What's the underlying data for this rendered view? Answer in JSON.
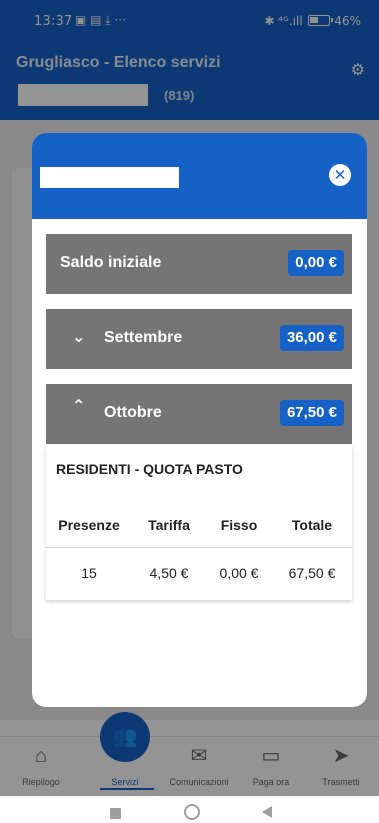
{
  "status_bar": {
    "time": "13:37",
    "left_icons": "▣ ▤ ⤓  ···",
    "signal": "✱ ⁴ᴳ.ıll",
    "battery": "46%"
  },
  "app_header": {
    "title": "Grugliasco - Elenco servizi",
    "count": "(819)",
    "settings_icon": "gear-icon"
  },
  "bottom_nav": {
    "items": [
      {
        "label": "Riepilogo",
        "icon": "home-icon"
      },
      {
        "label": "Servizi",
        "icon": "users-icon"
      },
      {
        "label": "Comunicazioni",
        "icon": "mail-icon"
      },
      {
        "label": "Paga ora",
        "icon": "wallet-icon"
      },
      {
        "label": "Trasmetti",
        "icon": "send-icon"
      }
    ]
  },
  "modal": {
    "close_icon": "close-icon",
    "rows": [
      {
        "label": "Saldo iniziale",
        "amount": "0,00 €",
        "expanded": null
      },
      {
        "label": "Settembre",
        "amount": "36,00 €",
        "expanded": false
      },
      {
        "label": "Ottobre",
        "amount": "67,50 €",
        "expanded": true
      }
    ],
    "detail": {
      "title": "RESIDENTI - QUOTA PASTO",
      "columns": [
        "Presenze",
        "Tariffa",
        "Fisso",
        "Totale"
      ],
      "rows": [
        [
          "15",
          "4,50 €",
          "0,00 €",
          "67,50 €"
        ]
      ]
    }
  },
  "colors": {
    "primary": "#1661c6",
    "row_gray": "#757575"
  }
}
